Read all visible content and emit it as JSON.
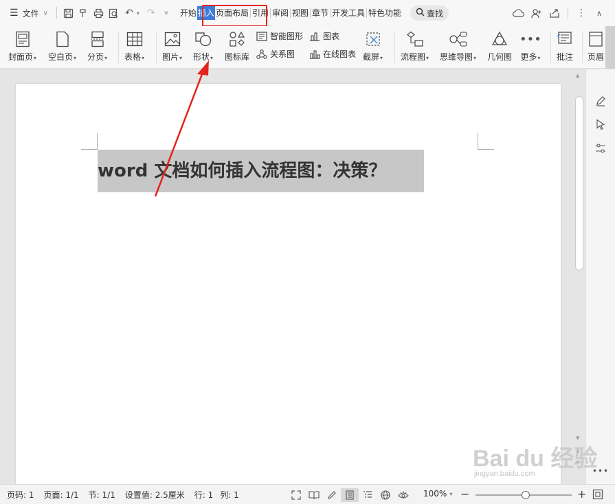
{
  "menubar": {
    "file_label": "文件",
    "tabs": [
      "开始",
      "插入",
      "页面布局",
      "引用",
      "审阅",
      "视图",
      "章节",
      "开发工具",
      "特色功能"
    ],
    "search_label": "查找"
  },
  "ribbon": {
    "cover": "封面页",
    "blank": "空白页",
    "pagebreak": "分页",
    "table": "表格",
    "picture": "图片",
    "shape": "形状",
    "iconlib": "图标库",
    "smartart": "智能图形",
    "chart": "图表",
    "relation": "关系图",
    "online_chart": "在线图表",
    "screenshot": "截屏",
    "flowchart": "流程图",
    "mindmap": "思维导图",
    "geometry": "几何图",
    "more": "更多",
    "comment": "批注",
    "header": "页眉"
  },
  "document": {
    "heading": "word 文档如何插入流程图：决策？"
  },
  "status": {
    "page_num": "页码: 1",
    "page": "页面: 1/1",
    "section": "节: 1/1",
    "setting": "设置值: 2.5厘米",
    "row": "行: 1",
    "col": "列: 1",
    "zoom": "100%",
    "zoom_fraction": 0.52
  },
  "watermark": {
    "main": "Bai du 经验",
    "sub": "jingyan.baidu.com"
  },
  "colors": {
    "active_tab": "#3d7bd9",
    "highlight_box": "#e3231d",
    "heading_bg": "#c7c7c7"
  }
}
